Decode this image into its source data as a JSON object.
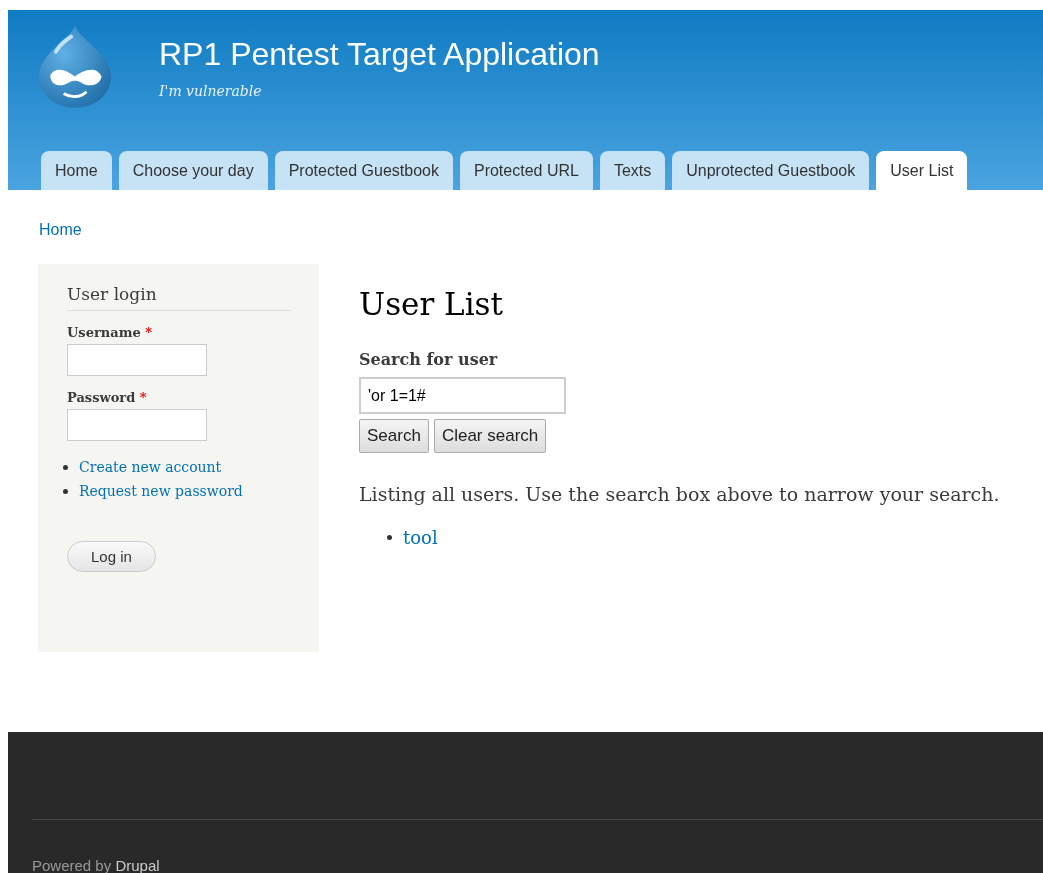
{
  "site": {
    "name": "RP1 Pentest Target Application",
    "slogan": "I'm vulnerable"
  },
  "tabs": [
    {
      "label": "Home",
      "selected": false
    },
    {
      "label": "Choose your day",
      "selected": false
    },
    {
      "label": "Protected Guestbook",
      "selected": false
    },
    {
      "label": "Protected URL",
      "selected": false
    },
    {
      "label": "Texts",
      "selected": false
    },
    {
      "label": "Unprotected Guestbook",
      "selected": false
    },
    {
      "label": "User List",
      "selected": true
    }
  ],
  "breadcrumb": [
    "Home"
  ],
  "login": {
    "title": "User login",
    "fields": [
      {
        "label": "Username",
        "required": "*"
      },
      {
        "label": "Password",
        "required": "*"
      }
    ],
    "links": [
      "Create new account",
      "Request new password"
    ],
    "button": "Log in"
  },
  "main": {
    "title": "User List",
    "search_label": "Search for user",
    "search_value": "'or 1=1#",
    "buttons": [
      "Search",
      "Clear search"
    ],
    "message": "Listing all users. Use the search box above to narrow your search.",
    "users": [
      "tool"
    ]
  },
  "footer": {
    "text": "Powered by",
    "link": "Drupal"
  }
}
